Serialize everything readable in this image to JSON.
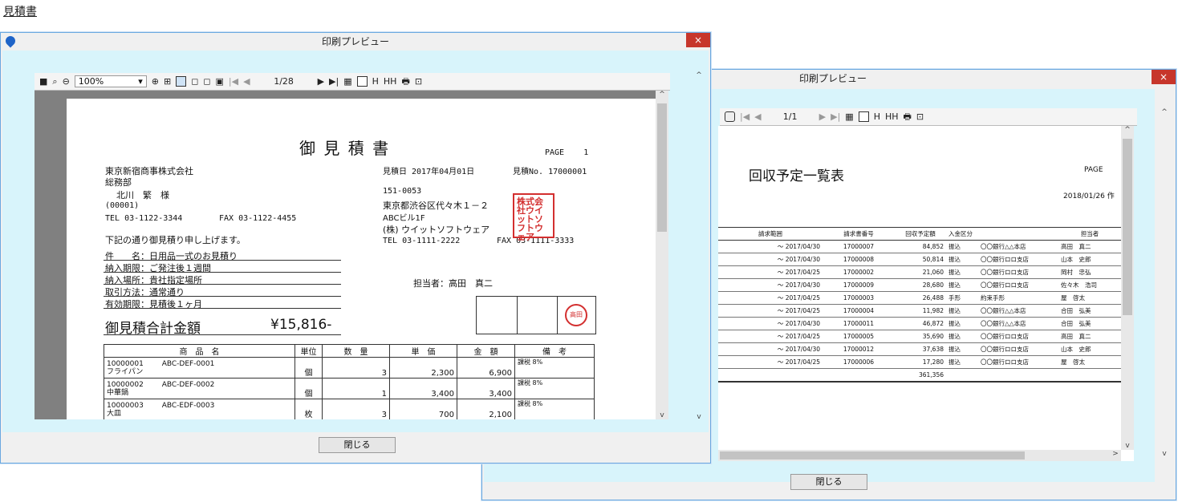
{
  "page": {
    "heading": "見積書"
  },
  "win1": {
    "title": "印刷プレビュー",
    "close": "×",
    "toolbar": {
      "zoom": "100%",
      "page": "1/28"
    },
    "close_button": "閉じる",
    "doc": {
      "title": "御 見 積 書",
      "page_label": "PAGE",
      "page_num": "1",
      "customer": {
        "company": "東京新宿商事株式会社",
        "dept": "総務部",
        "person": "北川　繁　様",
        "code": "(00001)",
        "tel": "TEL 03-1122-3344",
        "fax": "FAX 03-1122-4455"
      },
      "estimate_date": "見積日 2017年04月01日",
      "estimate_no": "見積No. 17000001",
      "sender": {
        "zip": "151-0053",
        "address": "東京都渋谷区代々木１－２",
        "building": "ABCビル1F",
        "company": "(株) ウイットソフトウェア",
        "tel": "TEL 03-1111-2222",
        "fax": "FAX 03-1111-3333"
      },
      "company_stamp": "株式会社ウイットソフトウェア",
      "intro": "下記の通り御見積り申し上げます。",
      "conditions": [
        "件　　名：日用品一式のお見積り",
        "納入期限：ご発注後１週間",
        "納入場所：貴社指定場所",
        "取引方法：通常通り",
        "有効期限：見積後１ヶ月"
      ],
      "rep": "担当者：高田　真二",
      "seal": "高田",
      "total_label": "御見積合計金額",
      "total_value": "¥15,816-",
      "table_headers": [
        "商　品　名",
        "単位",
        "数　量",
        "単　価",
        "金　額",
        "備　考"
      ],
      "items": [
        {
          "code": "10000001",
          "sku": "ABC-DEF-0001",
          "name": "フライパン",
          "unit": "個",
          "qty": "3",
          "price": "2,300",
          "amount": "6,900",
          "note": "課税 8%"
        },
        {
          "code": "10000002",
          "sku": "ABC-DEF-0002",
          "name": "中華鍋",
          "unit": "個",
          "qty": "1",
          "price": "3,400",
          "amount": "3,400",
          "note": "課税 8%"
        },
        {
          "code": "10000003",
          "sku": "ABC-EDF-0003",
          "name": "大皿",
          "unit": "枚",
          "qty": "3",
          "price": "700",
          "amount": "2,100",
          "note": "課税 8%"
        }
      ]
    }
  },
  "win2": {
    "title": "印刷プレビュー",
    "close": "×",
    "toolbar": {
      "page": "1/1"
    },
    "close_button": "閉じる",
    "doc": {
      "title": "回収予定一覧表",
      "page_label": "PAGE",
      "date": "2018/01/26 作",
      "headers": [
        "請求範囲",
        "請求書番号",
        "回収予定額",
        "入金区分",
        "",
        "担当者"
      ],
      "rows": [
        {
          "range": "～ 2017/04/30",
          "no": "17000007",
          "amount": "84,852",
          "kind": "振込",
          "bank": "〇〇銀行△△本店",
          "rep": "高田　真二"
        },
        {
          "range": "～ 2017/04/30",
          "no": "17000008",
          "amount": "50,814",
          "kind": "振込",
          "bank": "〇〇銀行ロロ支店",
          "rep": "山本　史郎"
        },
        {
          "range": "～ 2017/04/25",
          "no": "17000002",
          "amount": "21,060",
          "kind": "振込",
          "bank": "〇〇銀行ロロ支店",
          "rep": "岡村　忠弘"
        },
        {
          "range": "～ 2017/04/30",
          "no": "17000009",
          "amount": "28,680",
          "kind": "振込",
          "bank": "〇〇銀行ロロ支店",
          "rep": "佐々木　浩司"
        },
        {
          "range": "～ 2017/04/25",
          "no": "17000003",
          "amount": "26,488",
          "kind": "手形",
          "bank": "約束手形",
          "rep": "屋　啓太"
        },
        {
          "range": "～ 2017/04/25",
          "no": "17000004",
          "amount": "11,982",
          "kind": "振込",
          "bank": "〇〇銀行△△本店",
          "rep": "合田　弘美"
        },
        {
          "range": "～ 2017/04/30",
          "no": "17000011",
          "amount": "46,872",
          "kind": "振込",
          "bank": "〇〇銀行△△本店",
          "rep": "合田　弘美"
        },
        {
          "range": "～ 2017/04/25",
          "no": "17000005",
          "amount": "35,690",
          "kind": "振込",
          "bank": "〇〇銀行ロロ支店",
          "rep": "高田　真二"
        },
        {
          "range": "～ 2017/04/30",
          "no": "17000012",
          "amount": "37,638",
          "kind": "振込",
          "bank": "〇〇銀行ロロ支店",
          "rep": "山本　史郎"
        },
        {
          "range": "～ 2017/04/25",
          "no": "17000006",
          "amount": "17,280",
          "kind": "振込",
          "bank": "〇〇銀行ロロ支店",
          "rep": "屋　啓太"
        }
      ],
      "total": "361,356"
    }
  }
}
